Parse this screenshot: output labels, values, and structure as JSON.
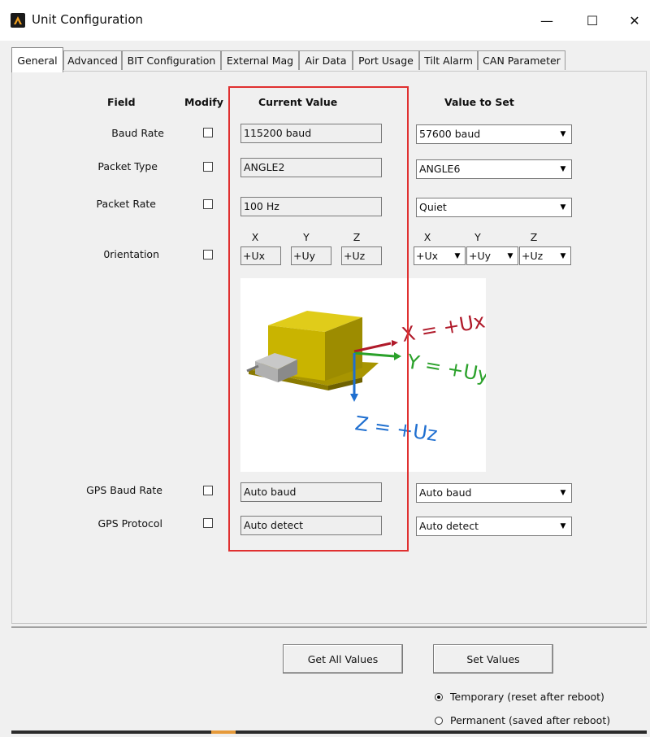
{
  "window": {
    "title": "Unit Configuration",
    "minimize_glyph": "—",
    "maximize_glyph": "☐",
    "close_glyph": "✕"
  },
  "tabs": [
    {
      "label": "General",
      "active": true
    },
    {
      "label": "Advanced"
    },
    {
      "label": "BIT Configuration"
    },
    {
      "label": "External Mag"
    },
    {
      "label": "Air Data"
    },
    {
      "label": "Port Usage"
    },
    {
      "label": "Tilt Alarm"
    },
    {
      "label": "CAN Parameter"
    }
  ],
  "headers": {
    "field": "Field",
    "modify": "Modify",
    "current": "Current Value",
    "value_to_set": "Value to Set"
  },
  "rows": {
    "baud_rate": {
      "label": "Baud Rate",
      "current": "115200 baud",
      "set": "57600 baud"
    },
    "packet_type": {
      "label": "Packet Type",
      "current": "ANGLE2",
      "set": "ANGLE6"
    },
    "packet_rate": {
      "label": "Packet Rate",
      "current": "100 Hz",
      "set": "Quiet"
    },
    "orientation": {
      "label": "0rientation",
      "axis_x": "X",
      "axis_y": "Y",
      "axis_z": "Z",
      "current_x": "+Ux",
      "current_y": "+Uy",
      "current_z": "+Uz",
      "set_x": "+Ux",
      "set_y": "+Uy",
      "set_z": "+Uz"
    },
    "gps_baud_rate": {
      "label": "GPS Baud Rate",
      "current": "Auto baud",
      "set": "Auto baud"
    },
    "gps_protocol": {
      "label": "GPS Protocol",
      "current": "Auto detect",
      "set": "Auto detect"
    }
  },
  "diagram": {
    "x_label": "X = +Ux",
    "y_label": "Y = +Uy",
    "z_label": "Z = +Uz",
    "x_color": "#b01a2a",
    "y_color": "#2aa12a",
    "z_color": "#1f6fd0"
  },
  "buttons": {
    "get_all": "Get All Values",
    "set_values": "Set Values"
  },
  "persistence": {
    "temporary": "Temporary (reset after reboot)",
    "permanent": "Permanent (saved after reboot)",
    "selected": "temporary"
  },
  "colors": {
    "highlight_box": "#e03030",
    "device_body": "#c9b400"
  }
}
